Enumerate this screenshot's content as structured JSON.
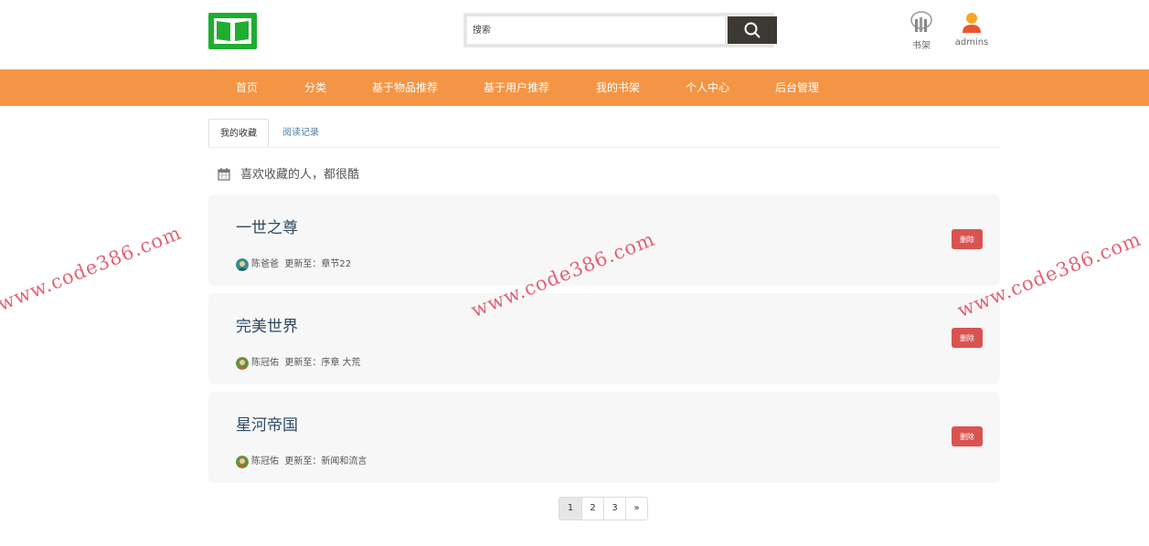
{
  "header": {
    "logo": "book-logo-icon",
    "search": {
      "placeholder": "搜索",
      "value": "",
      "button_icon": "search-icon"
    },
    "bookshelf": {
      "label": "书架",
      "icon": "bookshelf-icon"
    },
    "user": {
      "label": "admins",
      "icon": "user-icon"
    }
  },
  "nav": {
    "items": [
      "首页",
      "分类",
      "基于物品推荐",
      "基于用户推荐",
      "我的书架",
      "个人中心",
      "后台管理"
    ]
  },
  "tabs": [
    {
      "label": "我的收藏",
      "active": true
    },
    {
      "label": "阅读记录",
      "active": false
    }
  ],
  "section": {
    "icon": "calendar-icon",
    "title": "喜欢收藏的人，都很酷"
  },
  "books": [
    {
      "title": "一世之尊",
      "author": "陈爸爸",
      "update_label": "更新至：",
      "chapter": "章节22",
      "delete_label": "删除"
    },
    {
      "title": "完美世界",
      "author": "陈冠佑",
      "update_label": "更新至：",
      "chapter": "序章 大荒",
      "delete_label": "删除"
    },
    {
      "title": "星河帝国",
      "author": "陈冠佑",
      "update_label": "更新至：",
      "chapter": "新闻和流言",
      "delete_label": "删除"
    }
  ],
  "pagination": {
    "pages": [
      "1",
      "2",
      "3",
      "»"
    ],
    "current": "1"
  },
  "watermark": "www.code386.com",
  "colors": {
    "nav": "#f49545",
    "logo": "#1fae2f",
    "delete": "#d9534f",
    "title": "#2d4a63"
  }
}
